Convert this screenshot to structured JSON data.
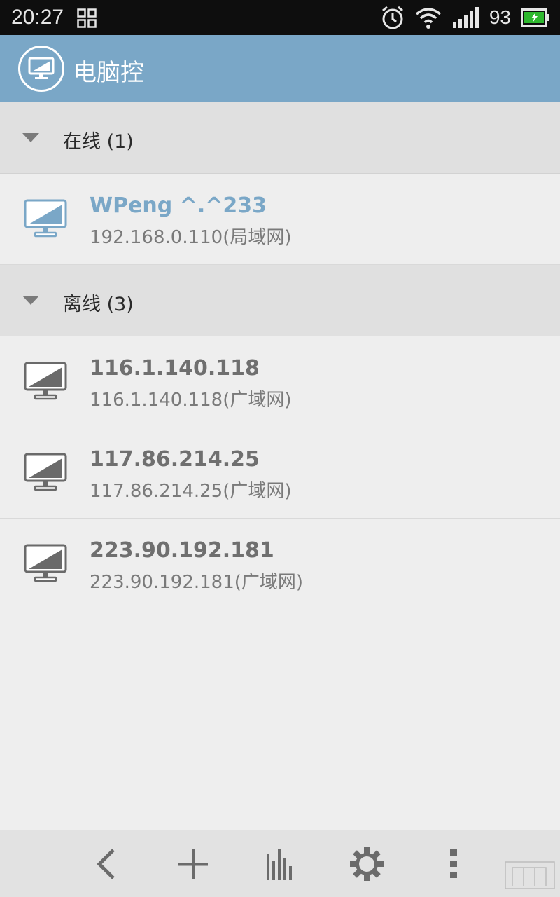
{
  "status_bar": {
    "time": "20:27",
    "battery_level": "93",
    "icons": [
      "grid-icon",
      "alarm-icon",
      "wifi-icon",
      "signal-icon",
      "battery-icon"
    ]
  },
  "app_bar": {
    "title": "电脑控",
    "logo_icon": "monitor-icon"
  },
  "groups": [
    {
      "label": "在线 (1)",
      "items": [
        {
          "name": "WPeng ^.^233",
          "address": "192.168.0.110(局域网)",
          "online": true
        }
      ]
    },
    {
      "label": "离线 (3)",
      "items": [
        {
          "name": "116.1.140.118",
          "address": "116.1.140.118(广域网)",
          "online": false
        },
        {
          "name": "117.86.214.25",
          "address": "117.86.214.25(广域网)",
          "online": false
        },
        {
          "name": "223.90.192.181",
          "address": "223.90.192.181(广域网)",
          "online": false
        }
      ]
    }
  ],
  "toolbar": {
    "buttons": [
      "back-icon",
      "add-icon",
      "stats-icon",
      "settings-icon",
      "more-icon"
    ]
  },
  "colors": {
    "accent": "#7aa7c7",
    "status_bar": "#0e0e0e",
    "battery_fill": "#2eb82e"
  }
}
